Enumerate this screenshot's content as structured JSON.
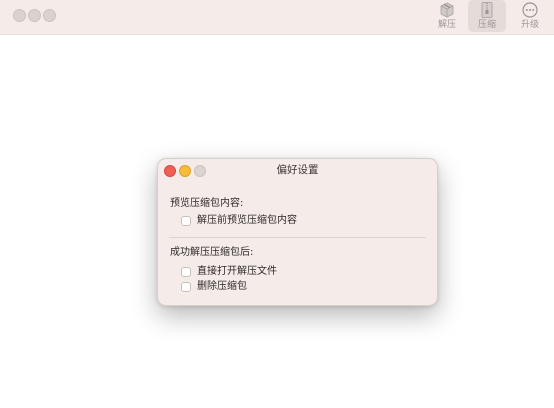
{
  "toolbar": {
    "buttons": [
      {
        "label": "解压",
        "icon": "archive-box-icon",
        "active": false
      },
      {
        "label": "压缩",
        "icon": "zipper-icon",
        "active": true
      },
      {
        "label": "升级",
        "icon": "ellipsis-circle-icon",
        "active": false
      }
    ]
  },
  "dialog": {
    "title": "偏好设置",
    "preview_section": {
      "label": "预览压缩包内容:",
      "options": [
        {
          "label": "解压前预览压缩包内容",
          "checked": false
        }
      ]
    },
    "after_section": {
      "label": "成功解压压缩包后:",
      "options": [
        {
          "label": "直接打开解压文件",
          "checked": false
        },
        {
          "label": "删除压缩包",
          "checked": false
        }
      ]
    }
  },
  "colors": {
    "toolbar_bg": "#f5ecea",
    "close": "#ee5f57",
    "minimize": "#f6bd3b",
    "zoom_inactive": "#dcd4d1"
  }
}
